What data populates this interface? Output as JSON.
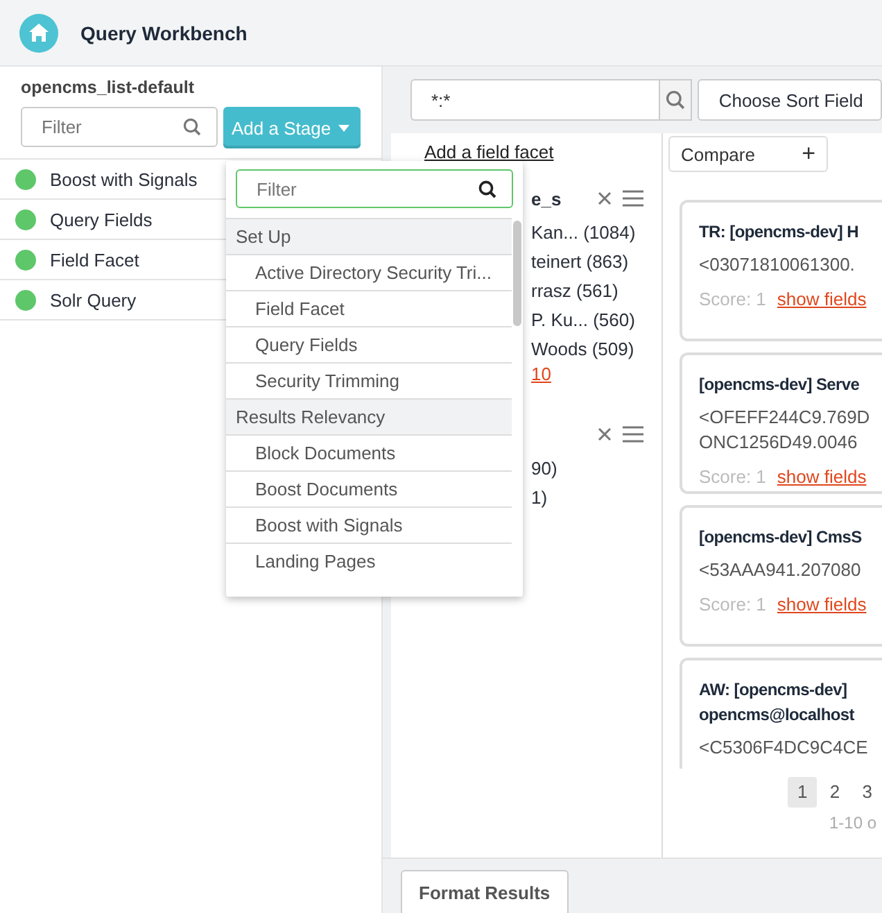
{
  "header": {
    "title": "Query Workbench"
  },
  "pipeline": {
    "name": "opencms_list-default",
    "filter_placeholder": "Filter",
    "add_button": "Add a Stage",
    "stages": [
      {
        "label": "Boost with Signals",
        "enabled": true
      },
      {
        "label": "Query Fields",
        "enabled": true
      },
      {
        "label": "Field Facet",
        "enabled": true
      },
      {
        "label": "Solr Query",
        "enabled": true
      }
    ]
  },
  "stage_menu": {
    "filter_placeholder": "Filter",
    "entries": [
      {
        "kind": "group",
        "label": "Set Up"
      },
      {
        "kind": "item",
        "label": "Active Directory Security Tri..."
      },
      {
        "kind": "item",
        "label": "Field Facet"
      },
      {
        "kind": "item",
        "label": "Query Fields"
      },
      {
        "kind": "item",
        "label": "Security Trimming"
      },
      {
        "kind": "group",
        "label": "Results Relevancy"
      },
      {
        "kind": "item",
        "label": "Block Documents"
      },
      {
        "kind": "item",
        "label": "Boost Documents"
      },
      {
        "kind": "item",
        "label": "Boost with Signals"
      },
      {
        "kind": "item",
        "label": "Landing Pages"
      }
    ]
  },
  "query": {
    "value": "*:*",
    "sort_placeholder": "Choose Sort Field"
  },
  "facets": {
    "add_link": "Add a field facet",
    "groups": [
      {
        "title": "e_s",
        "items": [
          {
            "label": "Kan...",
            "count": "(1084)"
          },
          {
            "label": "teinert",
            "count": "(863)"
          },
          {
            "label": "rrasz",
            "count": "(561)"
          },
          {
            "label": "P. Ku...",
            "count": "(560)"
          },
          {
            "label": "Woods",
            "count": "(509)"
          }
        ],
        "more_link": "10"
      },
      {
        "items": [
          {
            "count": "90)"
          },
          {
            "count": "1)"
          }
        ]
      }
    ]
  },
  "compare": {
    "label": "Compare",
    "icon": "+"
  },
  "results": [
    {
      "title": "TR: [opencms-dev] H",
      "id_lines": [
        "<03071810061300."
      ],
      "score": "Score: 1",
      "link": "show fields"
    },
    {
      "title": "[opencms-dev] Serve",
      "id_lines": [
        "<OFEFF244C9.769D",
        "ONC1256D49.0046"
      ],
      "score": "Score: 1",
      "link": "show fields"
    },
    {
      "title": "[opencms-dev] CmsS",
      "id_lines": [
        "<53AAA941.207080"
      ],
      "score": "Score: 1",
      "link": "show fields"
    },
    {
      "title": "AW: [opencms-dev]",
      "title_line2": "opencms@localhost",
      "id_lines": [
        "<C5306F4DC9C4CE"
      ]
    }
  ],
  "pagination": {
    "pages": [
      {
        "label": "1",
        "selected": true
      },
      {
        "label": "2",
        "selected": false
      },
      {
        "label": "3",
        "selected": false
      }
    ],
    "summary": "1-10 o"
  },
  "bottom_tabs": [
    {
      "label": "Format Results"
    }
  ]
}
